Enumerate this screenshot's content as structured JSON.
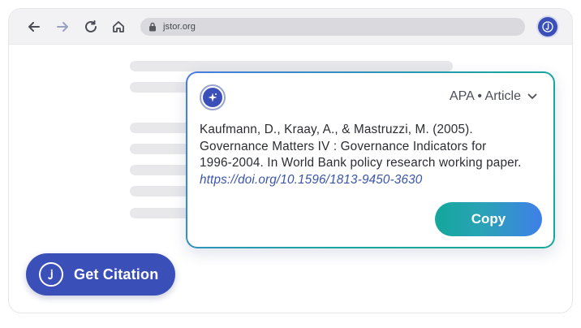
{
  "browser": {
    "url": "jstor.org",
    "icons": {
      "back": "arrow-left-icon",
      "forward": "arrow-right-icon",
      "reload": "reload-icon",
      "home": "home-icon",
      "lock": "lock-icon",
      "extension": "citation-extension-icon"
    }
  },
  "popup": {
    "logo_icon": "sparkle-icon",
    "style_label": "APA • Article",
    "style_icon": "chevron-down-icon",
    "citation": {
      "line1": "Kaufmann, D., Kraay, A., & Mastruzzi, M. (2005).",
      "line2": "Governance Matters IV : Governance Indicators for",
      "line3": "1996-2004. In World Bank policy research working paper.",
      "doi": "https://doi.org/10.1596/1813-9450-3630"
    },
    "copy_label": "Copy"
  },
  "cta": {
    "label": "Get Citation",
    "icon": "citation-logo-icon"
  },
  "colors": {
    "brand": "#3b4fb8",
    "accent_teal": "#14a79c",
    "accent_blue": "#3f7fe8"
  }
}
